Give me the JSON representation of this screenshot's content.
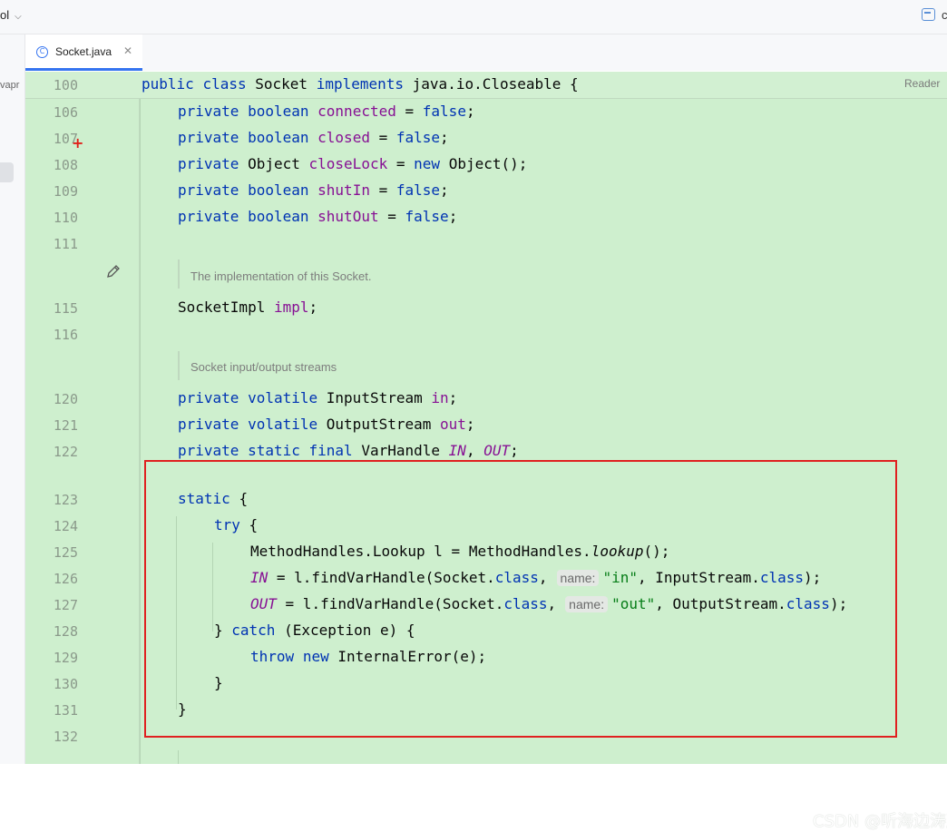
{
  "topbar": {
    "project_label": "ol",
    "right_label": "c"
  },
  "sidebar": {
    "label": "vapr"
  },
  "tab": {
    "icon": "C",
    "label": "Socket.java",
    "close": "✕"
  },
  "editor": {
    "reader_label": "Reader",
    "line_numbers": [
      "100",
      "106",
      "107",
      "108",
      "109",
      "110",
      "111",
      "115",
      "116",
      "120",
      "121",
      "122",
      "123",
      "124",
      "125",
      "126",
      "127",
      "128",
      "129",
      "130",
      "131",
      "132"
    ],
    "doc1": "The implementation of this Socket.",
    "doc2": "Socket input/output streams",
    "hint1": "name:",
    "hint2": "name:"
  },
  "code": {
    "l100": [
      "public",
      "class",
      "Socket",
      "implements",
      "java.io.Closeable {"
    ],
    "l106": [
      "private",
      "boolean",
      "connected",
      "=",
      "false",
      ";"
    ],
    "l107": [
      "private",
      "boolean",
      "closed",
      "=",
      "false",
      ";"
    ],
    "l108": [
      "private",
      "Object",
      "closeLock",
      "=",
      "new",
      "Object();"
    ],
    "l109": [
      "private",
      "boolean",
      "shutIn",
      "=",
      "false",
      ";"
    ],
    "l110": [
      "private",
      "boolean",
      "shutOut",
      "=",
      "false",
      ";"
    ],
    "l115": [
      "SocketImpl",
      "impl",
      ";"
    ],
    "l120": [
      "private",
      "volatile",
      "InputStream",
      "in",
      ";"
    ],
    "l121": [
      "private",
      "volatile",
      "OutputStream",
      "out",
      ";"
    ],
    "l122": [
      "private",
      "static",
      "final",
      "VarHandle",
      "IN",
      ",",
      "OUT",
      ";"
    ],
    "l123": [
      "static",
      "{"
    ],
    "l124": [
      "try",
      "{"
    ],
    "l125": [
      "MethodHandles.Lookup l = MethodHandles.",
      "lookup",
      "();"
    ],
    "l126": [
      "IN",
      " = l.findVarHandle(Socket.",
      "class",
      ",",
      "\"in\"",
      ", InputStream.",
      "class",
      ");"
    ],
    "l127": [
      "OUT",
      " = l.findVarHandle(Socket.",
      "class",
      ",",
      "\"out\"",
      ", OutputStream.",
      "class",
      ");"
    ],
    "l128": [
      "} ",
      "catch",
      " (Exception e) {"
    ],
    "l129": [
      "throw",
      "new",
      "InternalError(e);"
    ],
    "l130": [
      "}"
    ],
    "l131": [
      "}"
    ]
  },
  "watermark": "CSDN @听海边涛声",
  "colors": {
    "editor_bg": "#ceefce",
    "keyword": "#0033b3",
    "field": "#871094",
    "string": "#067d17",
    "highlight_box": "#e02020",
    "tab_accent": "#3574f0"
  },
  "icons": {
    "tab_icon": "java-class-icon",
    "gutter_edit": "pencil-icon",
    "gutter_marker": "plus-icon",
    "top_right": "window-icon"
  }
}
